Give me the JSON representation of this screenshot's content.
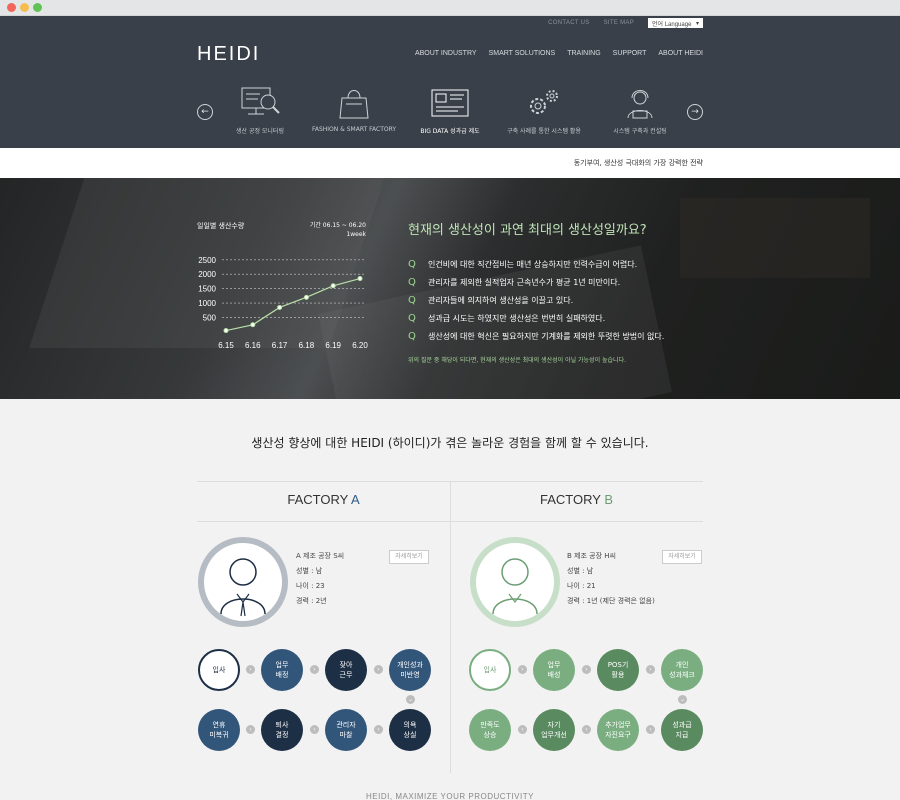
{
  "util": {
    "contact": "CONTACT US",
    "sitemap": "SITE MAP",
    "language": "언어 Language"
  },
  "logo": "HEIDI",
  "nav": [
    "ABOUT INDUSTRY",
    "SMART SOLUTIONS",
    "TRAINING",
    "SUPPORT",
    "ABOUT HEIDI"
  ],
  "services": [
    {
      "label": "생산 공정 모니터링",
      "icon": "monitor-search-icon"
    },
    {
      "label": "FASHION & SMART FACTORY",
      "icon": "shopping-bag-icon"
    },
    {
      "label": "BIG DATA 성과급 제도",
      "icon": "data-dashboard-icon"
    },
    {
      "label": "구축 사례를 통한 시스템 활용",
      "icon": "gears-icon"
    },
    {
      "label": "시스템 구축과 컨설팅",
      "icon": "consultant-headset-icon"
    }
  ],
  "slogan": "동기부여, 생산성 극대화의 가장 강력한 전략",
  "hero": {
    "chart_title": "일일별 생산수량",
    "chart_period": "기간 06.15 ~ 06.20",
    "chart_period2": "1week",
    "question": "현재의 생산성이 과연 최대의 생산성일까요?",
    "q_mark": "Q",
    "items": [
      "인건비에 대한 직간접비는 매년 상승하지만 인력수급이 어렵다.",
      "관리자를 제외한 실적업자 근속년수가 평균 1년 미만이다.",
      "관리자들에 의지하여 생산성을 이끌고 있다.",
      "성과급 시도는 하였지만 생산성은 번번히 실패하였다.",
      "생산성에 대한 혁신은 필요하지만 기계화를 제외한 뚜렷한 방법이 없다."
    ],
    "note": "위의 질문 중 해당이 되다면, 현재의 생산성은 최대의 생산성이 아닐 가능성이 높습니다."
  },
  "chart_data": {
    "type": "line",
    "categories": [
      "6.15",
      "6.16",
      "6.17",
      "6.18",
      "6.19",
      "6.20"
    ],
    "values": [
      50,
      250,
      850,
      1200,
      1600,
      1850
    ],
    "yticks": [
      500,
      1000,
      1500,
      2000,
      2500
    ],
    "ylim": [
      0,
      2700
    ],
    "grid": true
  },
  "main": {
    "title": "생산성 향상에 대한 HEIDI (하이디)가 겪은 놀라운 경험을 함께 할 수 있습니다.",
    "detail_label": "자세히보기",
    "footer": "HEIDI, MAXIMIZE YOUR PRODUCTIVITY",
    "factory_a": {
      "name": "FACTORY ",
      "letter": "A",
      "profile": [
        "A 제조 공장 S씨",
        "성별 : 남",
        "나이 : 23",
        "경력 : 2년"
      ],
      "steps": [
        "입사",
        "업무\n배정",
        "잦아\n근무",
        "개인성과\n미반영",
        "의욕\n상실",
        "관리자\n마찰",
        "퇴사\n결정",
        "연휴\n미복귀"
      ]
    },
    "factory_b": {
      "name": "FACTORY ",
      "letter": "B",
      "profile": [
        "B 제조 공장 H씨",
        "성별 : 남",
        "나이 : 21",
        "경력 : 1년  (제단 경력은 없음)"
      ],
      "steps": [
        "입사",
        "업무\n배성",
        "POS기\n활용",
        "개인\n성과체크",
        "성과급\n지급",
        "추가업무\n자진요구",
        "자기\n업무개선",
        "만족도\n상승"
      ]
    }
  },
  "colors": {
    "header": "#3a4049",
    "factory_a": "#32557a",
    "factory_b": "#7aae81",
    "accent_q": "#9fd891"
  }
}
